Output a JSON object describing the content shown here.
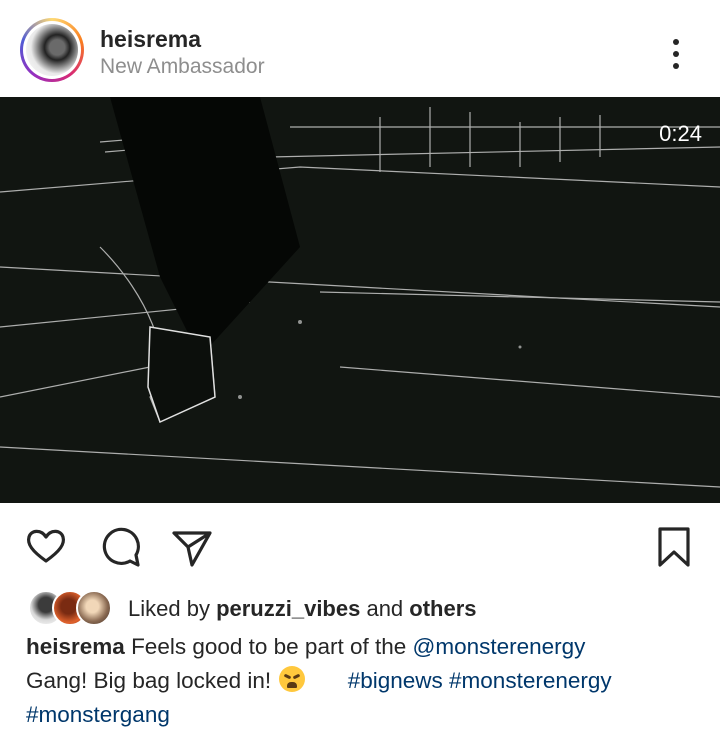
{
  "post": {
    "username": "heisrema",
    "subtitle": "New Ambassador",
    "video_time": "0:24",
    "liked_prefix": "Liked by ",
    "liked_user": "peruzzi_vibes",
    "liked_and": " and ",
    "liked_others": "others",
    "caption_user": "heisrema",
    "caption_text1": " Feels good to be part of the ",
    "mention": "@monsterenergy",
    "caption_text2": " Gang! Big bag locked in! ",
    "tags": [
      "#bignews",
      "#monsterenergy",
      "#monstergang"
    ]
  },
  "icons": {
    "more": "more-vertical-icon",
    "like": "heart-icon",
    "comment": "comment-icon",
    "share": "send-icon",
    "save": "bookmark-icon",
    "emoji": "steam-from-nose-emoji"
  },
  "colors": {
    "text": "#262626",
    "secondary": "#8e8e8e",
    "link": "#00376b",
    "video_bg": "#101410"
  }
}
